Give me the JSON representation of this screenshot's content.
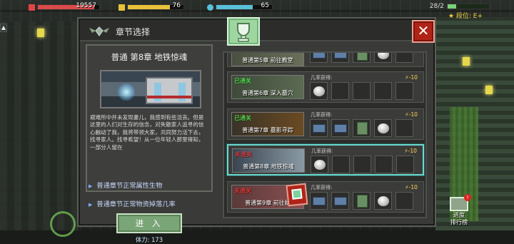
{
  "hud": {
    "health": {
      "value": "19557",
      "fill": 0.92,
      "color": "#d94a4a"
    },
    "gold": {
      "value": "76",
      "fill": 0.76,
      "color": "#e8c23a"
    },
    "energy": {
      "value": "65",
      "fill": 0.65,
      "color": "#58c0d8"
    },
    "small_count": "28/2",
    "rank_label": "段位: E+"
  },
  "panel": {
    "title": "章节选择",
    "close_label": "✕"
  },
  "chapter": {
    "title": "普通 第8章 地铁惊魂",
    "description": "避难所中并未发现妻儿，我感到有些沮丧。但是这里的人们对生存的信念，对失散家人追寻的信心触动了我，我将带领大家，共同努力活下去，找寻家人。找寻希望！从一位年轻人那里得知，一部分人留在",
    "link1": "普通章节正常属性生物",
    "link2": "普通章节正常物资掉落几率",
    "enter": "进 入",
    "stamina": "体力: 173"
  },
  "list": {
    "drop_label": "几率获得:",
    "energy_cost": "-10",
    "rows": [
      {
        "caption": "普通第5章 前往教堂",
        "cleared": ""
      },
      {
        "caption": "普通第6章 深入墓穴",
        "cleared": "已通关"
      },
      {
        "caption": "普通第7章 墓影寻踪",
        "cleared": "已通关"
      },
      {
        "caption": "普通第8章 地铁惊魂",
        "cleared": "未通关"
      },
      {
        "caption": "普通第9章 前往机",
        "cleared": "未通关"
      }
    ]
  },
  "leaderboard": {
    "badge": "!",
    "line1": "进度",
    "line2": "排行榜"
  },
  "left_button": "▲"
}
